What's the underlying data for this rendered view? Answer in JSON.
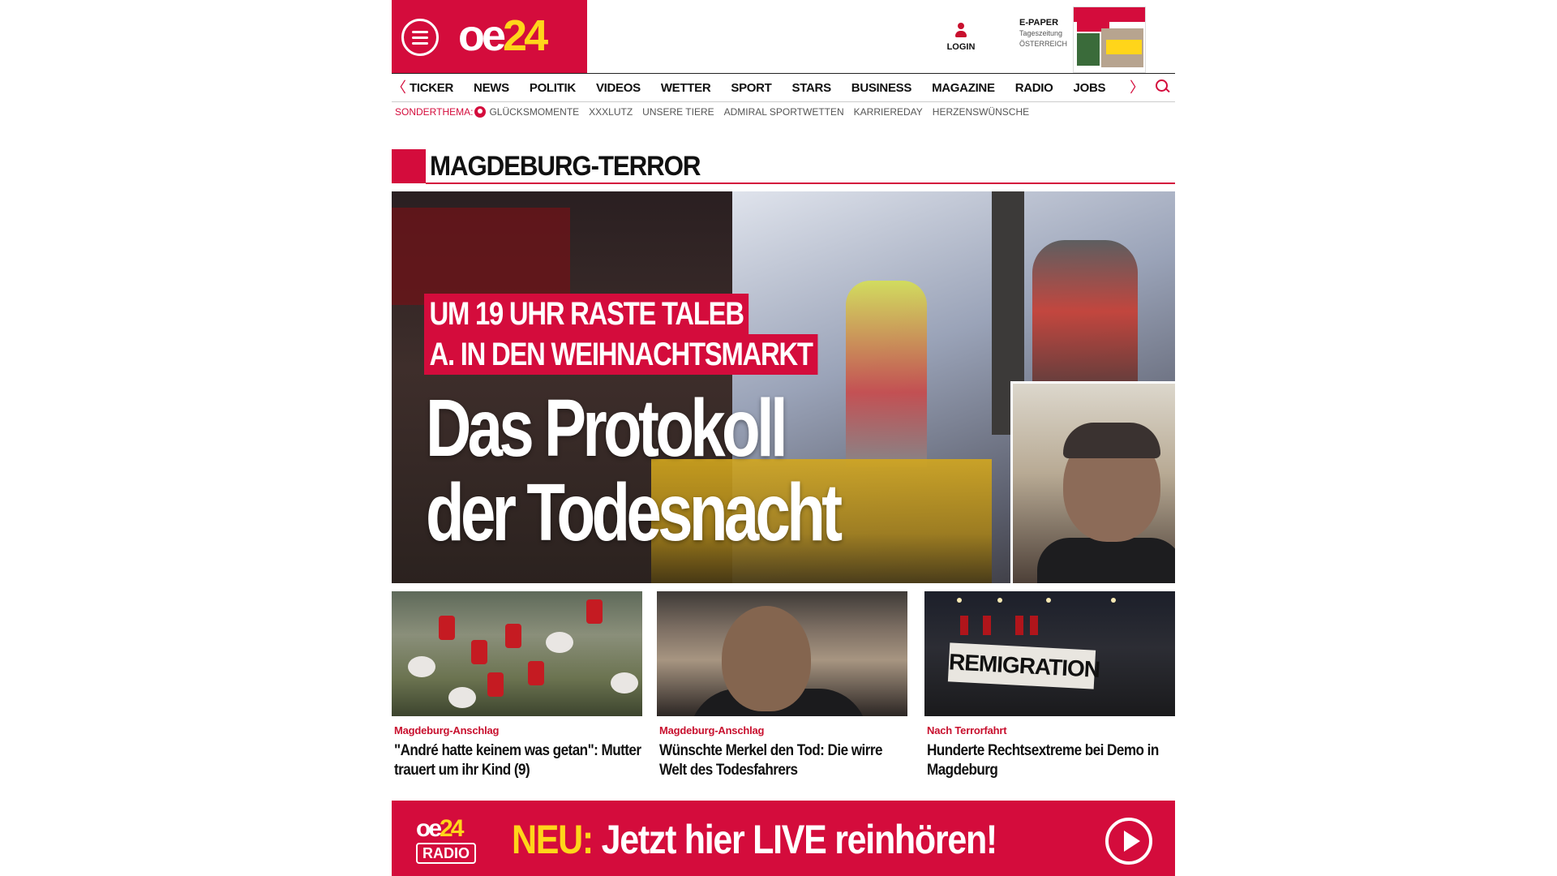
{
  "header": {
    "logo_prefix": "oe",
    "logo_suffix": "24",
    "login_label": "LOGIN",
    "epaper_title": "E-PAPER",
    "epaper_sub1": "Tageszeitung",
    "epaper_sub2": "ÖSTERREICH"
  },
  "nav": {
    "prev_arrow": "〈",
    "next_arrow": "〉",
    "items": [
      "TICKER",
      "NEWS",
      "POLITIK",
      "VIDEOS",
      "WETTER",
      "SPORT",
      "STARS",
      "BUSINESS",
      "MAGAZINE",
      "RADIO",
      "JOBS"
    ]
  },
  "subnav": {
    "label": "SONDERTHEMA:",
    "items": [
      "GLÜCKSMOMENTE",
      "XXXLUTZ",
      "UNSERE TIERE",
      "ADMIRAL SPORTWETTEN",
      "KARRIEREDAY",
      "HERZENSWÜNSCHE"
    ]
  },
  "section": {
    "title": "MAGDEBURG-TERROR"
  },
  "hero": {
    "kicker_line1": "UM 19 UHR RASTE TALEB",
    "kicker_line2": "A. IN DEN WEIHNACHTSMARKT",
    "title_line1": "Das Protokoll",
    "title_line2": "der Todesnacht"
  },
  "cards": [
    {
      "kicker": "Magdeburg-Anschlag",
      "title": "\"André hatte keinem was getan\": Mutter trauert um ihr Kind (9)"
    },
    {
      "kicker": "Magdeburg-Anschlag",
      "title": "Wünschte Merkel den Tod: Die wirre Welt des Todesfahrers"
    },
    {
      "kicker": "Nach Terrorfahrt",
      "title": "Hunderte Rechtsextreme bei Demo in Magdeburg",
      "image_text": "REMIGRATION"
    }
  ],
  "radio": {
    "logo_prefix": "oe",
    "logo_suffix": "24",
    "logo_tag": "RADIO",
    "neu": "NEU:",
    "text": "Jetzt hier LIVE reinhören!"
  },
  "colors": {
    "brand_red": "#d40c3c",
    "brand_yellow": "#ffd51a"
  }
}
